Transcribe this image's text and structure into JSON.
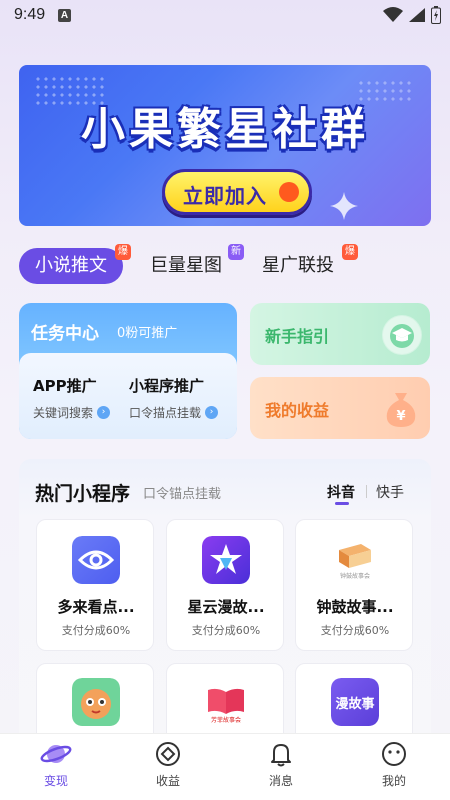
{
  "status_bar": {
    "time": "9:49",
    "notification_glyph": "A"
  },
  "banner": {
    "title": "小果繁星社群",
    "button_label": "立即加入"
  },
  "tabs": [
    {
      "label": "小说推文",
      "badge": "爆",
      "active": true
    },
    {
      "label": "巨量星图",
      "badge": "新",
      "active": false
    },
    {
      "label": "星广联投",
      "badge": "爆",
      "active": false
    }
  ],
  "task_center": {
    "title": "任务中心",
    "subtitle": "0粉可推广",
    "columns": [
      {
        "title": "APP推广",
        "desc": "关键词搜索"
      },
      {
        "title": "小程序推广",
        "desc": "口令描点挂载"
      }
    ]
  },
  "guide": {
    "label": "新手指引"
  },
  "earnings": {
    "label": "我的收益"
  },
  "mini_programs": {
    "title": "热门小程序",
    "subtitle": "口令锚点挂载",
    "platform_tabs": [
      {
        "label": "抖音",
        "active": true
      },
      {
        "label": "快手",
        "active": false
      }
    ],
    "apps": [
      {
        "name": "多来看点...",
        "rate": "支付分成60%",
        "icon": "eye-logo-icon"
      },
      {
        "name": "星云漫故...",
        "rate": "支付分成60%",
        "icon": "star-cloud-logo-icon"
      },
      {
        "name": "钟鼓故事...",
        "rate": "支付分成60%",
        "icon": "book-logo-icon"
      },
      {
        "name": "",
        "rate": "",
        "icon": "cartoon-logo-icon"
      },
      {
        "name": "",
        "rate": "",
        "icon": "open-book-logo-icon"
      },
      {
        "name": "",
        "rate": "",
        "icon": "comic-logo-icon"
      }
    ],
    "app_logo_captions": {
      "book": "钟鼓故事会",
      "open_book": "芳菲故事会",
      "comic": "漫故事"
    }
  },
  "nav": [
    {
      "label": "变现",
      "icon": "planet-icon",
      "active": true
    },
    {
      "label": "收益",
      "icon": "coin-icon",
      "active": false
    },
    {
      "label": "消息",
      "icon": "bell-icon",
      "active": false
    },
    {
      "label": "我的",
      "icon": "smiley-icon",
      "active": false
    }
  ],
  "colors": {
    "accent": "#6a4de4",
    "badge_red": "#ff5b3a",
    "badge_purple": "#8a5cf5",
    "guide_green": "#3bb76d",
    "earn_orange": "#ef7b2c"
  }
}
